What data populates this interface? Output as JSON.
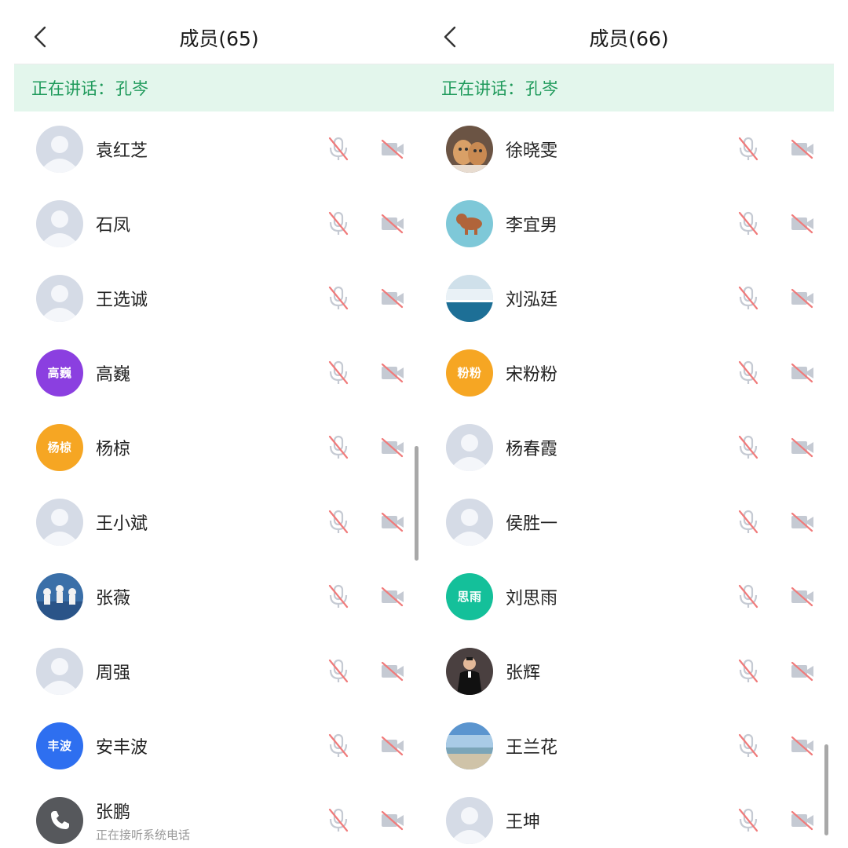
{
  "left": {
    "title": "成员(65)",
    "speaking_label": "正在讲话：",
    "speaking_name": "孔岑",
    "members": [
      {
        "name": "袁红芝",
        "avatar": "placeholder"
      },
      {
        "name": "石凤",
        "avatar": "placeholder"
      },
      {
        "name": "王选诚",
        "avatar": "placeholder"
      },
      {
        "name": "高巍",
        "avatar": "text",
        "avatar_text": "高巍",
        "color": "#8b3fe0"
      },
      {
        "name": "杨椋",
        "avatar": "text",
        "avatar_text": "杨椋",
        "color": "#f6a623"
      },
      {
        "name": "王小斌",
        "avatar": "placeholder"
      },
      {
        "name": "张薇",
        "avatar": "photo",
        "photo": "photo-people"
      },
      {
        "name": "周强",
        "avatar": "placeholder"
      },
      {
        "name": "安丰波",
        "avatar": "text",
        "avatar_text": "丰波",
        "color": "#2e6ff0"
      },
      {
        "name": "张鹏",
        "avatar": "phone",
        "status": "正在接听系统电话",
        "color": "#56585c"
      }
    ]
  },
  "right": {
    "title": "成员(66)",
    "speaking_label": "正在讲话：",
    "speaking_name": "孔岑",
    "members": [
      {
        "name": "徐晓雯",
        "avatar": "photo",
        "photo": "photo-cats"
      },
      {
        "name": "李宜男",
        "avatar": "photo",
        "photo": "photo-dog"
      },
      {
        "name": "刘泓廷",
        "avatar": "photo",
        "photo": "photo-sea"
      },
      {
        "name": "宋粉粉",
        "avatar": "text",
        "avatar_text": "粉粉",
        "color": "#f6a623"
      },
      {
        "name": "杨春霞",
        "avatar": "placeholder"
      },
      {
        "name": "侯胜一",
        "avatar": "placeholder"
      },
      {
        "name": "刘思雨",
        "avatar": "text",
        "avatar_text": "思雨",
        "color": "#14c09a"
      },
      {
        "name": "张辉",
        "avatar": "photo",
        "photo": "photo-man"
      },
      {
        "name": "王兰花",
        "avatar": "photo",
        "photo": "photo-beach"
      },
      {
        "name": "王坤",
        "avatar": "placeholder"
      }
    ]
  },
  "icons": {
    "back": "chevron-left-icon",
    "mic": "mic-muted-icon",
    "camera": "camera-off-icon"
  },
  "colors": {
    "speaking_bg": "#e3f6ec",
    "speaking_text": "#1f9a5b",
    "placeholder_bg": "#d5dbe6",
    "muted_red": "#f07b7b",
    "icon_gray": "#c5cad3"
  }
}
